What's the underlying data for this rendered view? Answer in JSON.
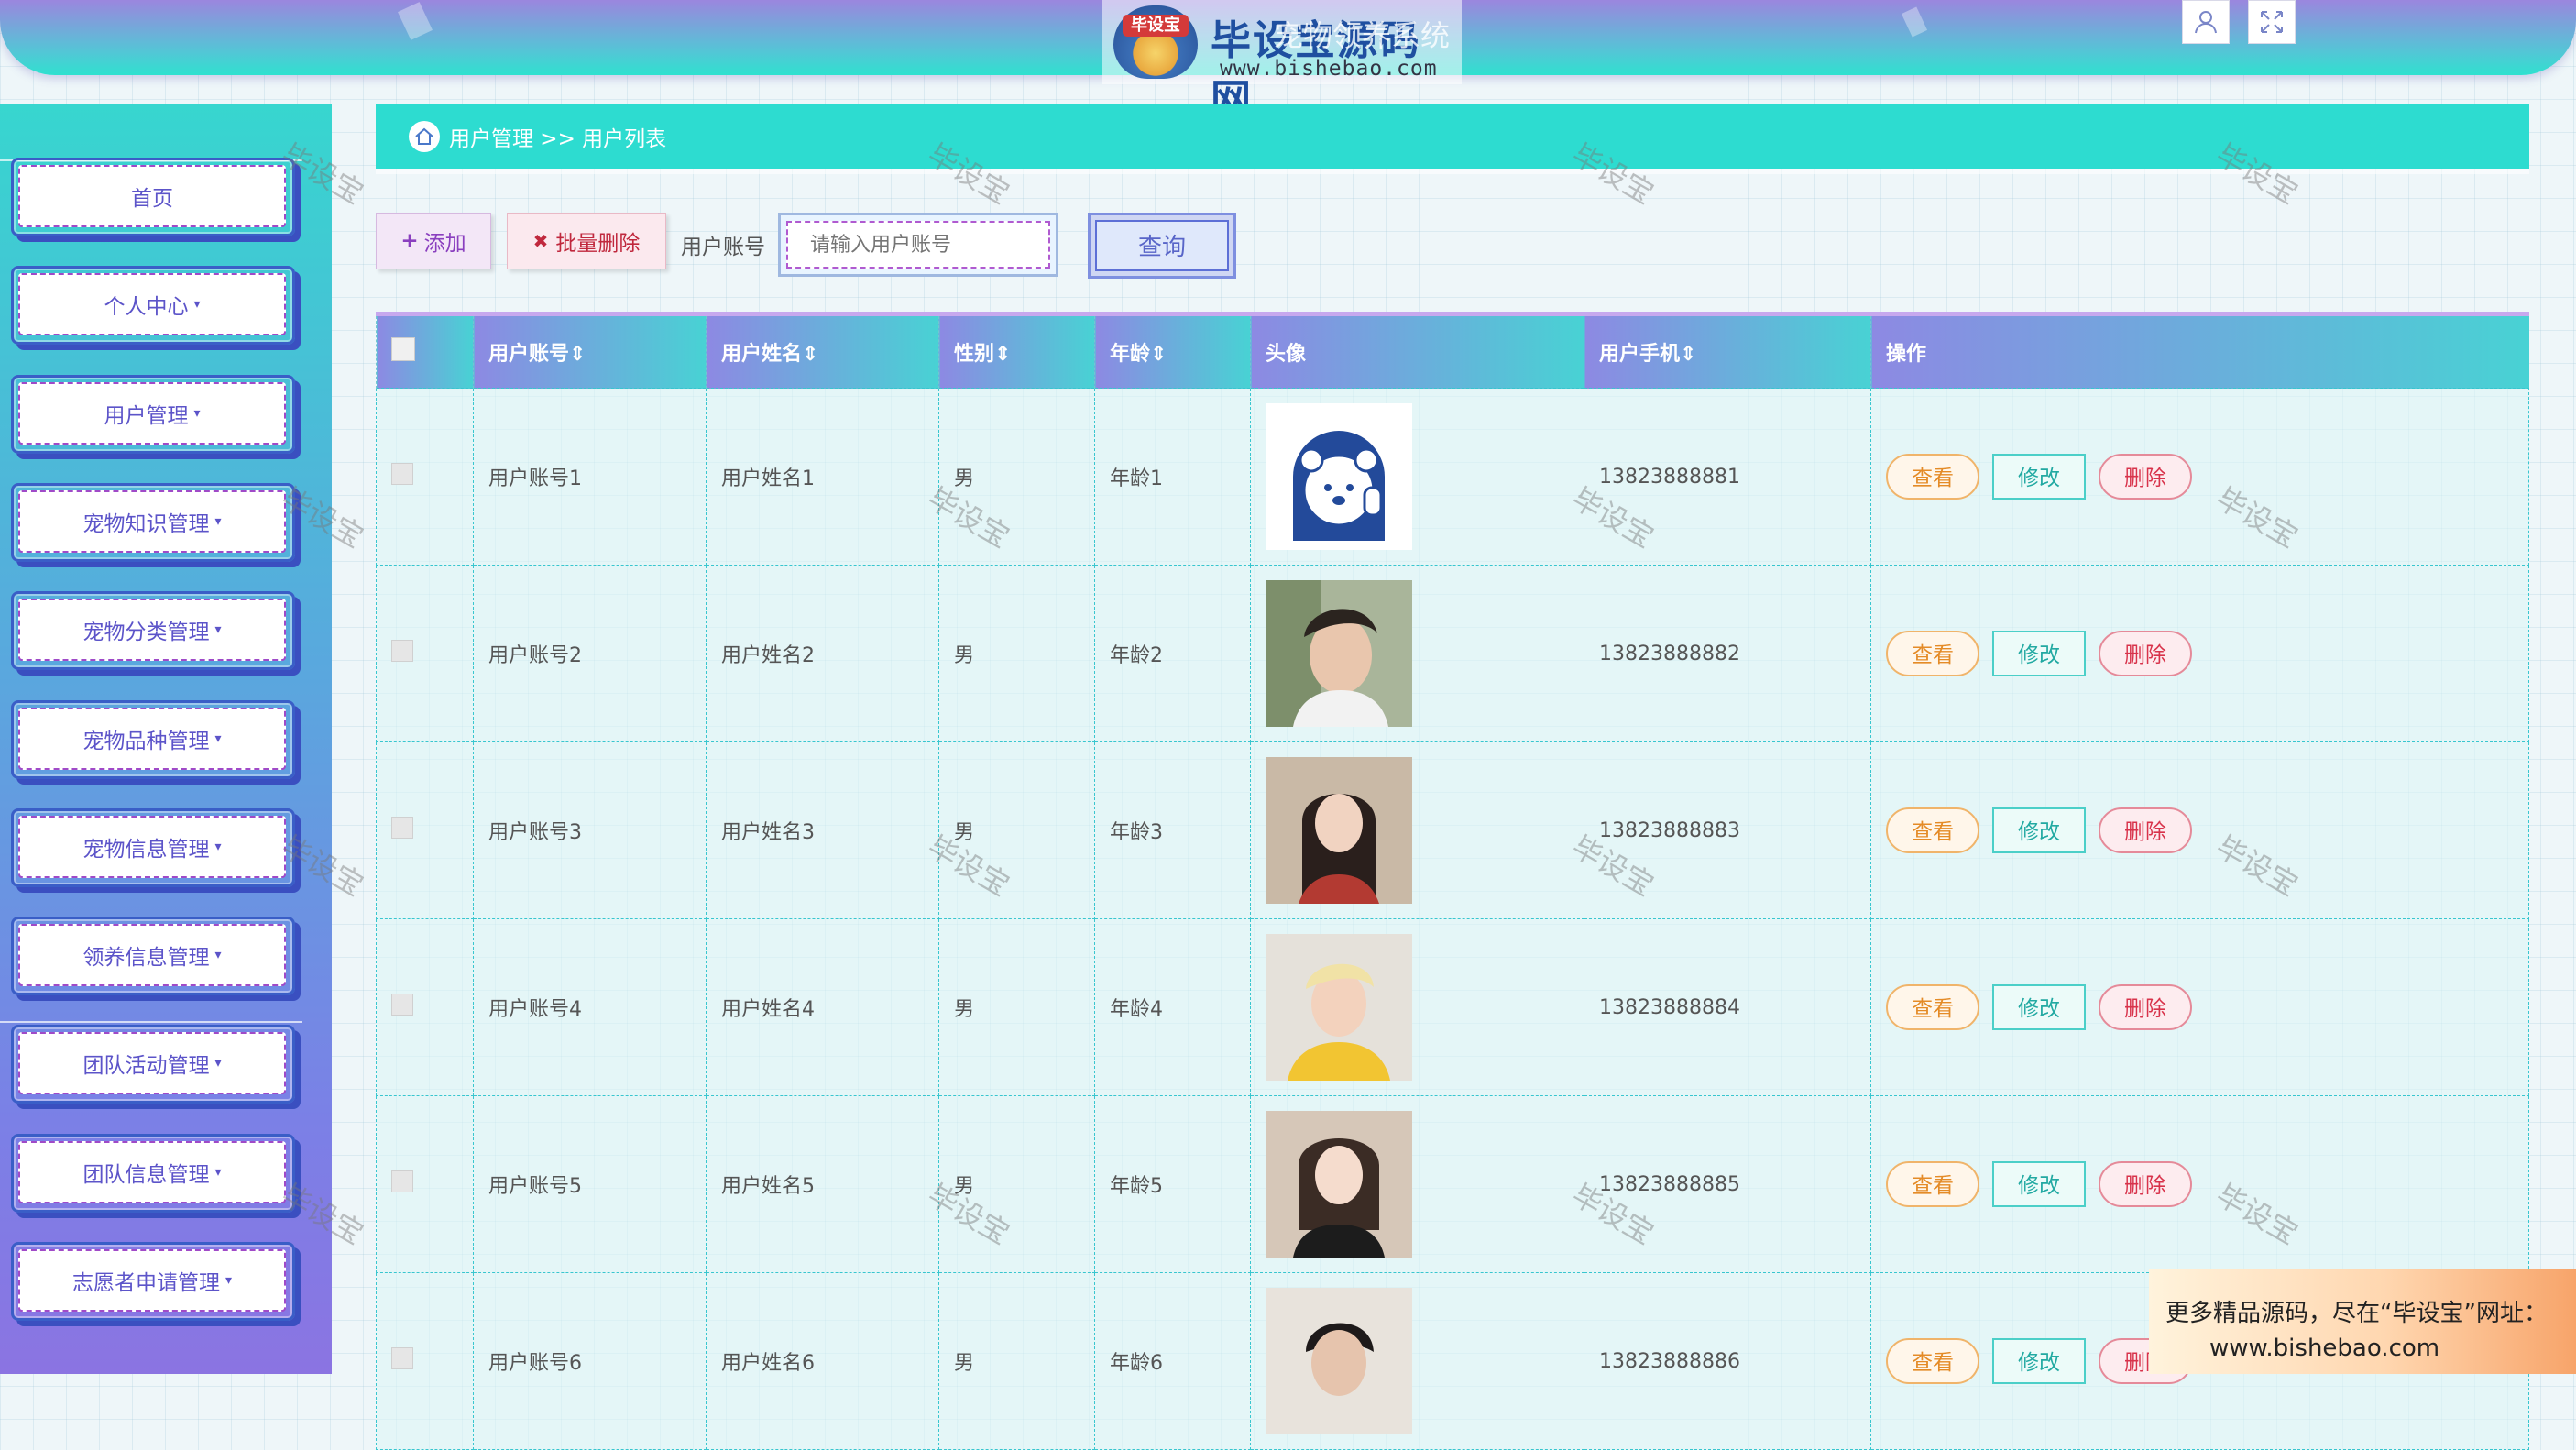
{
  "header": {
    "logo_badge": "毕设宝",
    "logo_title": "毕设宝源码网",
    "logo_url": "www.bishebao.com",
    "logo_overlay_text": "宠物领养系统",
    "buttons": [
      {
        "icon": "user-icon"
      },
      {
        "icon": "fullscreen-icon"
      }
    ]
  },
  "sidebar": {
    "items": [
      {
        "label": "首页",
        "has_caret": false
      },
      {
        "label": "个人中心",
        "has_caret": true
      },
      {
        "label": "用户管理",
        "has_caret": true
      },
      {
        "label": "宠物知识管理",
        "has_caret": true
      },
      {
        "label": "宠物分类管理",
        "has_caret": true
      },
      {
        "label": "宠物品种管理",
        "has_caret": true
      },
      {
        "label": "宠物信息管理",
        "has_caret": true
      },
      {
        "label": "领养信息管理",
        "has_caret": true
      },
      {
        "label": "团队活动管理",
        "has_caret": true
      },
      {
        "label": "团队信息管理",
        "has_caret": true
      },
      {
        "label": "志愿者申请管理",
        "has_caret": true
      }
    ]
  },
  "breadcrumb": {
    "icon": "home-icon",
    "text": "用户管理 >> 用户列表"
  },
  "toolbar": {
    "add_label": "添加",
    "add_icon": "+",
    "batch_delete_label": "批量删除",
    "batch_delete_icon": "✖",
    "search_label": "用户账号",
    "search_placeholder": "请输入用户账号",
    "query_label": "查询"
  },
  "table": {
    "columns": [
      "用户账号",
      "用户姓名",
      "性别",
      "年龄",
      "头像",
      "用户手机",
      "操作"
    ],
    "sort_glyph": "⇕",
    "actions": {
      "view": "查看",
      "edit": "修改",
      "delete": "删除"
    },
    "rows": [
      {
        "account": "用户账号1",
        "name": "用户姓名1",
        "gender": "男",
        "age": "年龄1",
        "avatar": "bear-cartoon",
        "phone": "13823888881"
      },
      {
        "account": "用户账号2",
        "name": "用户姓名2",
        "gender": "男",
        "age": "年龄2",
        "avatar": "young-man-portrait",
        "phone": "13823888882"
      },
      {
        "account": "用户账号3",
        "name": "用户姓名3",
        "gender": "男",
        "age": "年龄3",
        "avatar": "young-woman-portrait",
        "phone": "13823888883"
      },
      {
        "account": "用户账号4",
        "name": "用户姓名4",
        "gender": "男",
        "age": "年龄4",
        "avatar": "blond-man-yellow-shirt",
        "phone": "13823888884"
      },
      {
        "account": "用户账号5",
        "name": "用户姓名5",
        "gender": "男",
        "age": "年龄5",
        "avatar": "woman-black-top",
        "phone": "13823888885"
      },
      {
        "account": "用户账号6",
        "name": "用户姓名6",
        "gender": "男",
        "age": "年龄6",
        "avatar": "man-dark-hair",
        "phone": "13823888886"
      }
    ]
  },
  "watermark_text": "毕设宝",
  "promo": {
    "line1": "更多精品源码，尽在“毕设宝”网址：",
    "line2": "www.bishebao.com"
  },
  "colors": {
    "accent_teal": "#2ddcd0",
    "accent_purple": "#8b74e2",
    "view_orange": "#e48b27",
    "edit_teal": "#22a9a2",
    "delete_red": "#d8334b"
  }
}
